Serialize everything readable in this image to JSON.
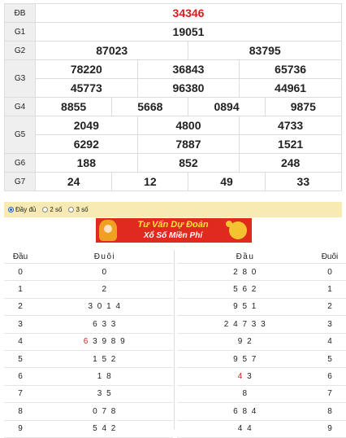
{
  "results": {
    "special": {
      "label": "ĐB",
      "number": "34346"
    },
    "g1": {
      "label": "G1",
      "numbers": [
        "19051"
      ]
    },
    "g2": {
      "label": "G2",
      "numbers": [
        "87023",
        "83795"
      ]
    },
    "g3": {
      "label": "G3",
      "numbers": [
        "78220",
        "36843",
        "65736",
        "45773",
        "96380",
        "44961"
      ]
    },
    "g4": {
      "label": "G4",
      "numbers": [
        "8855",
        "5668",
        "0894",
        "9875"
      ]
    },
    "g5": {
      "label": "G5",
      "numbers": [
        "2049",
        "4800",
        "4733",
        "6292",
        "7887",
        "1521"
      ]
    },
    "g6": {
      "label": "G6",
      "numbers": [
        "188",
        "852",
        "248"
      ]
    },
    "g7": {
      "label": "G7",
      "numbers": [
        "24",
        "12",
        "49",
        "33"
      ]
    }
  },
  "display_options": {
    "selected": "full",
    "options": [
      {
        "value": "full",
        "label": "Đầy đủ"
      },
      {
        "value": "2",
        "label": "2 số"
      },
      {
        "value": "3",
        "label": "3 số"
      }
    ]
  },
  "banner": {
    "line1": "Tư Vấn Dự Đoán",
    "line2": "Xổ Số Miền Phí"
  },
  "loto_left": {
    "header_head": "Đầu",
    "header_tail": "Đuôi",
    "rows": [
      {
        "head": "0",
        "tail": "0",
        "tail_red": "",
        "tail_rest": "0"
      },
      {
        "head": "1",
        "tail": "2",
        "tail_red": "",
        "tail_rest": "2"
      },
      {
        "head": "2",
        "tail": "3 0 1 4",
        "tail_red": "",
        "tail_rest": "3 0 1 4"
      },
      {
        "head": "3",
        "tail": "6 3 3",
        "tail_red": "",
        "tail_rest": "6 3 3"
      },
      {
        "head": "4",
        "tail": "6 3 9 8 9",
        "tail_red": "6",
        "tail_rest": "3 9 8 9"
      },
      {
        "head": "5",
        "tail": "1 5 2",
        "tail_red": "",
        "tail_rest": "1 5 2"
      },
      {
        "head": "6",
        "tail": "1 8",
        "tail_red": "",
        "tail_rest": "1 8"
      },
      {
        "head": "7",
        "tail": "3 5",
        "tail_red": "",
        "tail_rest": "3 5"
      },
      {
        "head": "8",
        "tail": "0 7 8",
        "tail_red": "",
        "tail_rest": "0 7 8"
      },
      {
        "head": "9",
        "tail": "5 4 2",
        "tail_red": "",
        "tail_rest": "5 4 2"
      }
    ]
  },
  "loto_right": {
    "header_head": "Đầu",
    "header_tail": "Đuôi",
    "rows": [
      {
        "head_values": "2 8 0",
        "head_red": "",
        "head_rest": "2 8 0",
        "tail": "0"
      },
      {
        "head_values": "5 6 2",
        "head_red": "",
        "head_rest": "5 6 2",
        "tail": "1"
      },
      {
        "head_values": "9 5 1",
        "head_red": "",
        "head_rest": "9 5 1",
        "tail": "2"
      },
      {
        "head_values": "2 4 7 3 3",
        "head_red": "",
        "head_rest": "2 4 7 3 3",
        "tail": "3"
      },
      {
        "head_values": "9 2",
        "head_red": "",
        "head_rest": "9 2",
        "tail": "4"
      },
      {
        "head_values": "9 5 7",
        "head_red": "",
        "head_rest": "9 5 7",
        "tail": "5"
      },
      {
        "head_values": "4 3",
        "head_red": "4",
        "head_rest": "3",
        "tail": "6"
      },
      {
        "head_values": "8",
        "head_red": "",
        "head_rest": "8",
        "tail": "7"
      },
      {
        "head_values": "6 8 4",
        "head_red": "",
        "head_rest": "6 8 4",
        "tail": "8"
      },
      {
        "head_values": "4 4",
        "head_red": "",
        "head_rest": "4 4",
        "tail": "9"
      }
    ]
  },
  "colors": {
    "special_number": "#e0191b",
    "label_bg": "#efefef",
    "options_bg": "#f7eab2",
    "banner_bg": "#e02a1f"
  }
}
